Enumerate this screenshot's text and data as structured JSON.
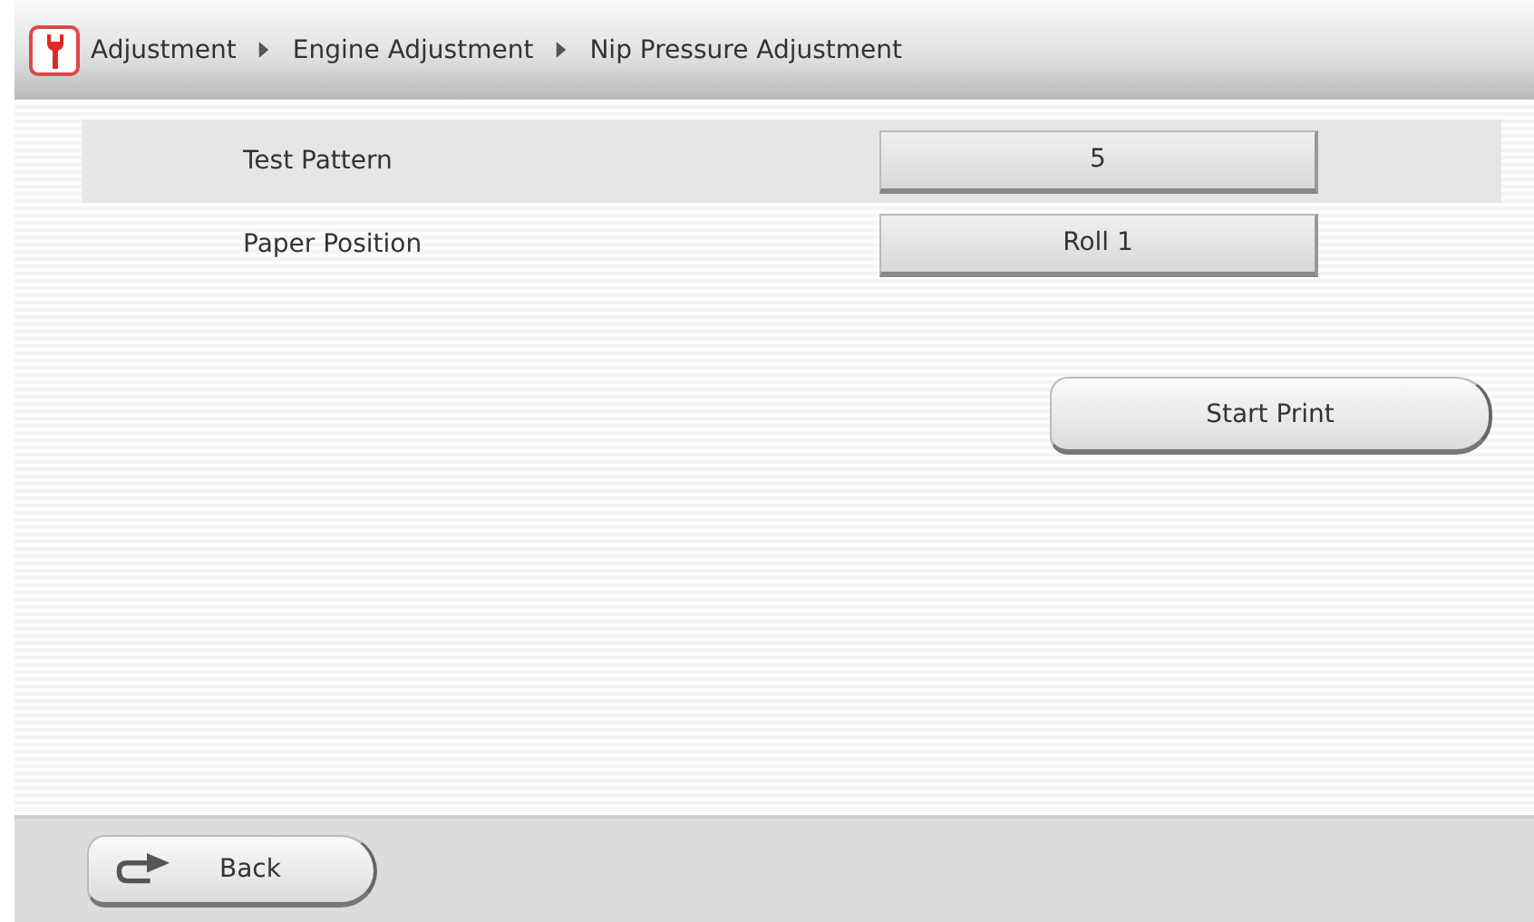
{
  "breadcrumb": [
    "Adjustment",
    "Engine Adjustment",
    "Nip Pressure Adjustment"
  ],
  "settings": [
    {
      "label": "Test Pattern",
      "value": "5",
      "selected": true
    },
    {
      "label": "Paper Position",
      "value": "Roll 1",
      "selected": false
    }
  ],
  "action_button": "Start Print",
  "footer": {
    "back_button": "Back"
  }
}
